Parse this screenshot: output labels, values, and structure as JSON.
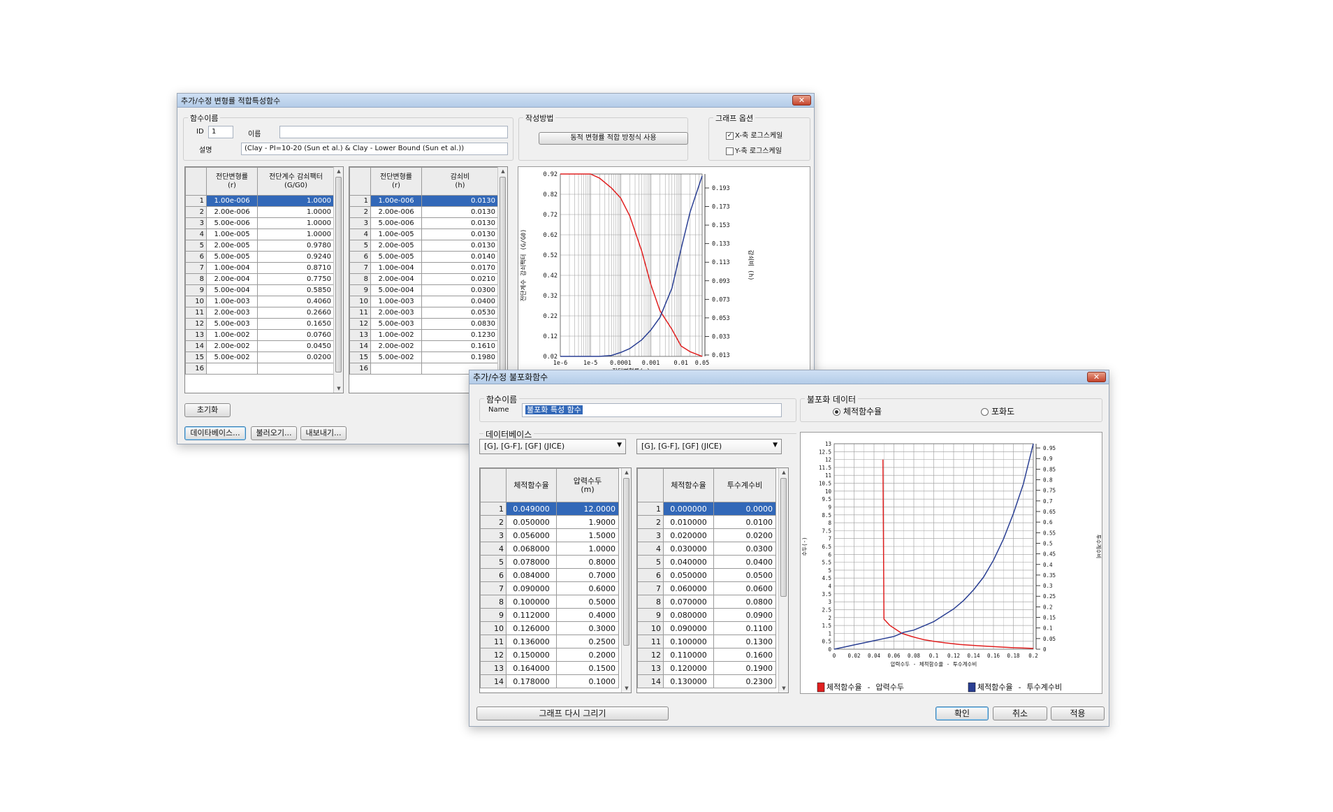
{
  "win1": {
    "title": "추가/수정 변형률 적합특성함수",
    "func_group": "함수이름",
    "id_label": "ID",
    "id_value": "1",
    "name_label": "이름",
    "name_value": "",
    "desc_label": "설명",
    "desc_value": "(Clay - PI=10-20 (Sun et al.) & Clay - Lower Bound (Sun et al.))",
    "method_group": "작성방법",
    "method_button": "동적 변형률 적합 방정식 사용",
    "graph_group": "그래프 옵션",
    "x_log": "X-축 로그스케일",
    "y_log": "Y-축 로그스케일",
    "grid1": {
      "h1": "전단변형률",
      "h1b": "(r)",
      "h2": "전단계수 감쇠팩터",
      "h2b": "(G/G0)",
      "rows": [
        [
          "1",
          "1.00e-006",
          "1.0000"
        ],
        [
          "2",
          "2.00e-006",
          "1.0000"
        ],
        [
          "3",
          "5.00e-006",
          "1.0000"
        ],
        [
          "4",
          "1.00e-005",
          "1.0000"
        ],
        [
          "5",
          "2.00e-005",
          "0.9780"
        ],
        [
          "6",
          "5.00e-005",
          "0.9240"
        ],
        [
          "7",
          "1.00e-004",
          "0.8710"
        ],
        [
          "8",
          "2.00e-004",
          "0.7750"
        ],
        [
          "9",
          "5.00e-004",
          "0.5850"
        ],
        [
          "10",
          "1.00e-003",
          "0.4060"
        ],
        [
          "11",
          "2.00e-003",
          "0.2660"
        ],
        [
          "12",
          "5.00e-003",
          "0.1650"
        ],
        [
          "13",
          "1.00e-002",
          "0.0760"
        ],
        [
          "14",
          "2.00e-002",
          "0.0450"
        ],
        [
          "15",
          "5.00e-002",
          "0.0200"
        ],
        [
          "16",
          "",
          ""
        ]
      ]
    },
    "grid2": {
      "h1": "전단변형률",
      "h1b": "(r)",
      "h2": "감쇠비",
      "h2b": "(h)",
      "rows": [
        [
          "1",
          "1.00e-006",
          "0.0130"
        ],
        [
          "2",
          "2.00e-006",
          "0.0130"
        ],
        [
          "3",
          "5.00e-006",
          "0.0130"
        ],
        [
          "4",
          "1.00e-005",
          "0.0130"
        ],
        [
          "5",
          "2.00e-005",
          "0.0130"
        ],
        [
          "6",
          "5.00e-005",
          "0.0140"
        ],
        [
          "7",
          "1.00e-004",
          "0.0170"
        ],
        [
          "8",
          "2.00e-004",
          "0.0210"
        ],
        [
          "9",
          "5.00e-004",
          "0.0300"
        ],
        [
          "10",
          "1.00e-003",
          "0.0400"
        ],
        [
          "11",
          "2.00e-003",
          "0.0530"
        ],
        [
          "12",
          "5.00e-003",
          "0.0830"
        ],
        [
          "13",
          "1.00e-002",
          "0.1230"
        ],
        [
          "14",
          "2.00e-002",
          "0.1610"
        ],
        [
          "15",
          "5.00e-002",
          "0.1980"
        ],
        [
          "16",
          "",
          ""
        ]
      ]
    },
    "reset_button": "초기화",
    "db_button": "데이타베이스...",
    "load_button": "불러오기...",
    "export_button": "내보내기..."
  },
  "win2": {
    "title": "추가/수정 불포화함수",
    "func_group": "함수이름",
    "name_label": "Name",
    "name_value": "불포화 특성 함수",
    "db_group": "데이터베이스",
    "combo1": "[G], [G-F], [GF] (JICE)",
    "combo2": "[G], [G-F], [GF] (JICE)",
    "unsat_group": "불포화 데이터",
    "radio1": "체적함수율",
    "radio2": "포화도",
    "grid1": {
      "h1": "체적함수율",
      "h2": "압력수두",
      "h2b": "(m)",
      "rows": [
        [
          "1",
          "0.049000",
          "12.0000"
        ],
        [
          "2",
          "0.050000",
          "1.9000"
        ],
        [
          "3",
          "0.056000",
          "1.5000"
        ],
        [
          "4",
          "0.068000",
          "1.0000"
        ],
        [
          "5",
          "0.078000",
          "0.8000"
        ],
        [
          "6",
          "0.084000",
          "0.7000"
        ],
        [
          "7",
          "0.090000",
          "0.6000"
        ],
        [
          "8",
          "0.100000",
          "0.5000"
        ],
        [
          "9",
          "0.112000",
          "0.4000"
        ],
        [
          "10",
          "0.126000",
          "0.3000"
        ],
        [
          "11",
          "0.136000",
          "0.2500"
        ],
        [
          "12",
          "0.150000",
          "0.2000"
        ],
        [
          "13",
          "0.164000",
          "0.1500"
        ],
        [
          "14",
          "0.178000",
          "0.1000"
        ]
      ]
    },
    "grid2": {
      "h1": "체적함수율",
      "h2": "투수계수비",
      "rows": [
        [
          "1",
          "0.000000",
          "0.0000"
        ],
        [
          "2",
          "0.010000",
          "0.0100"
        ],
        [
          "3",
          "0.020000",
          "0.0200"
        ],
        [
          "4",
          "0.030000",
          "0.0300"
        ],
        [
          "5",
          "0.040000",
          "0.0400"
        ],
        [
          "6",
          "0.050000",
          "0.0500"
        ],
        [
          "7",
          "0.060000",
          "0.0600"
        ],
        [
          "8",
          "0.070000",
          "0.0800"
        ],
        [
          "9",
          "0.080000",
          "0.0900"
        ],
        [
          "10",
          "0.090000",
          "0.1100"
        ],
        [
          "11",
          "0.100000",
          "0.1300"
        ],
        [
          "12",
          "0.110000",
          "0.1600"
        ],
        [
          "13",
          "0.120000",
          "0.1900"
        ],
        [
          "14",
          "0.130000",
          "0.2300"
        ]
      ]
    },
    "redraw_button": "그래프 다시 그리기",
    "ok_button": "확인",
    "cancel_button": "취소",
    "apply_button": "적용"
  },
  "colors": {
    "red": "#e02020",
    "blue": "#2a3f93",
    "selection": "#3268b8"
  },
  "chart_data": [
    {
      "type": "line",
      "xlabel": "전단변형률(r)",
      "ylabel": "전단계수 감쇠팩터 (G/G0)",
      "y2label": "감쇠비 (h)",
      "xscale": "log",
      "xlim": [
        1e-06,
        0.05
      ],
      "ylim": [
        0.02,
        1.0
      ],
      "y2lim": [
        0.013,
        0.2
      ],
      "xticks": [
        "1e-6",
        "1e-5",
        "0.0001",
        "0.001",
        "0.01",
        "0.05"
      ],
      "yticks": [
        "0.02",
        "0.12",
        "0.22",
        "0.32",
        "0.42",
        "0.52",
        "0.62",
        "0.72",
        "0.82",
        "0.92"
      ],
      "y2ticks": [
        "0.013",
        "0.033",
        "0.053",
        "0.073",
        "0.093",
        "0.113",
        "0.133",
        "0.153",
        "0.173",
        "0.193"
      ],
      "grid": true,
      "series": [
        {
          "axis": "left",
          "color": "#e02020",
          "x": [
            1e-06,
            2e-06,
            5e-06,
            1e-05,
            2e-05,
            5e-05,
            0.0001,
            0.0002,
            0.0005,
            0.001,
            0.002,
            0.005,
            0.01,
            0.02,
            0.05
          ],
          "values": [
            1.0,
            1.0,
            1.0,
            1.0,
            0.978,
            0.924,
            0.871,
            0.775,
            0.585,
            0.406,
            0.266,
            0.165,
            0.076,
            0.045,
            0.02
          ]
        },
        {
          "axis": "right",
          "color": "#2a3f93",
          "x": [
            1e-06,
            2e-06,
            5e-06,
            1e-05,
            2e-05,
            5e-05,
            0.0001,
            0.0002,
            0.0005,
            0.001,
            0.002,
            0.005,
            0.01,
            0.02,
            0.05
          ],
          "values": [
            0.013,
            0.013,
            0.013,
            0.013,
            0.013,
            0.014,
            0.017,
            0.021,
            0.03,
            0.04,
            0.053,
            0.083,
            0.123,
            0.161,
            0.198
          ]
        }
      ]
    },
    {
      "type": "line",
      "xlabel": "압력수두 - 체적함수율 - 투수계수비",
      "ylabel": "수두(-)",
      "y2label": "투수계수비",
      "xlim": [
        0,
        0.2
      ],
      "ylim": [
        0,
        13
      ],
      "y2lim": [
        0,
        0.97
      ],
      "xticks": [
        "0",
        "0.02",
        "0.04",
        "0.06",
        "0.08",
        "0.1",
        "0.12",
        "0.14",
        "0.16",
        "0.18",
        "0.2"
      ],
      "yticks": [
        "0",
        "0.5",
        "1",
        "1.5",
        "2",
        "2.5",
        "3",
        "3.5",
        "4",
        "4.5",
        "5",
        "5.5",
        "6",
        "6.5",
        "7",
        "7.5",
        "8",
        "8.5",
        "9",
        "9.5",
        "10",
        "10.5",
        "11",
        "11.5",
        "12",
        "12.5",
        "13"
      ],
      "y2ticks": [
        "0",
        "0.05",
        "0.1",
        "0.15",
        "0.2",
        "0.25",
        "0.3",
        "0.35",
        "0.4",
        "0.45",
        "0.5",
        "0.55",
        "0.6",
        "0.65",
        "0.7",
        "0.75",
        "0.8",
        "0.85",
        "0.9",
        "0.95"
      ],
      "grid": true,
      "legend": "bottom",
      "series": [
        {
          "name": "체적함수율 - 압력수두",
          "axis": "left",
          "color": "#e02020",
          "x": [
            0.049,
            0.05,
            0.056,
            0.068,
            0.078,
            0.084,
            0.09,
            0.1,
            0.112,
            0.126,
            0.136,
            0.15,
            0.164,
            0.178,
            0.2
          ],
          "values": [
            12,
            1.9,
            1.5,
            1.0,
            0.8,
            0.7,
            0.6,
            0.5,
            0.4,
            0.3,
            0.25,
            0.2,
            0.15,
            0.1,
            0.05
          ]
        },
        {
          "name": "체적함수율 - 투수계수비",
          "axis": "right",
          "color": "#2a3f93",
          "x": [
            0,
            0.01,
            0.02,
            0.03,
            0.04,
            0.05,
            0.06,
            0.07,
            0.08,
            0.09,
            0.1,
            0.11,
            0.12,
            0.13,
            0.14,
            0.15,
            0.16,
            0.17,
            0.18,
            0.19,
            0.2
          ],
          "values": [
            0,
            0.01,
            0.02,
            0.03,
            0.04,
            0.05,
            0.06,
            0.08,
            0.09,
            0.11,
            0.13,
            0.16,
            0.19,
            0.23,
            0.28,
            0.34,
            0.42,
            0.52,
            0.64,
            0.78,
            0.97
          ]
        }
      ]
    }
  ]
}
